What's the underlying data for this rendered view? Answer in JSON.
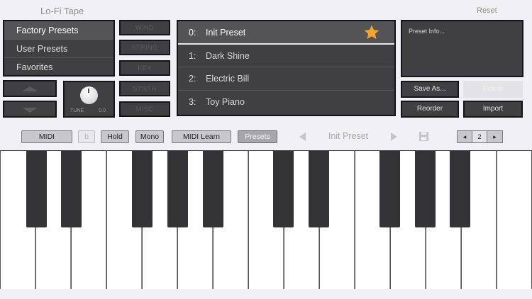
{
  "header": {
    "title": "Lo-Fi Tape",
    "reset_label": "Reset"
  },
  "categories": {
    "items": [
      {
        "label": "Factory Presets"
      },
      {
        "label": "User Presets"
      },
      {
        "label": "Favorites"
      }
    ]
  },
  "tune": {
    "label": "TUNE",
    "value": "0.0"
  },
  "sound_types": {
    "items": [
      {
        "label": "WIND"
      },
      {
        "label": "STRING"
      },
      {
        "label": "KEY"
      },
      {
        "label": "SYNTH"
      },
      {
        "label": "MISC"
      }
    ]
  },
  "presets": {
    "items": [
      {
        "num": "0:",
        "name": "Init Preset"
      },
      {
        "num": "1:",
        "name": "Dark Shine"
      },
      {
        "num": "2:",
        "name": "Electric Bill"
      },
      {
        "num": "3:",
        "name": "Toy Piano"
      }
    ]
  },
  "info": {
    "text": "Preset Info..."
  },
  "actions": {
    "save_as": "Save As...",
    "delete": "Delete",
    "reorder": "Reorder",
    "import": "Import"
  },
  "toolbar": {
    "midi": "MIDI",
    "b": "b",
    "hold": "Hold",
    "mono": "Mono",
    "midi_learn": "MIDI Learn",
    "presets": "Presets",
    "current_preset": "Init Preset"
  },
  "octave": {
    "value": "2"
  },
  "colors": {
    "panel": "#404043",
    "star": "#f2a531",
    "accent_active": "#a7a7ab"
  }
}
